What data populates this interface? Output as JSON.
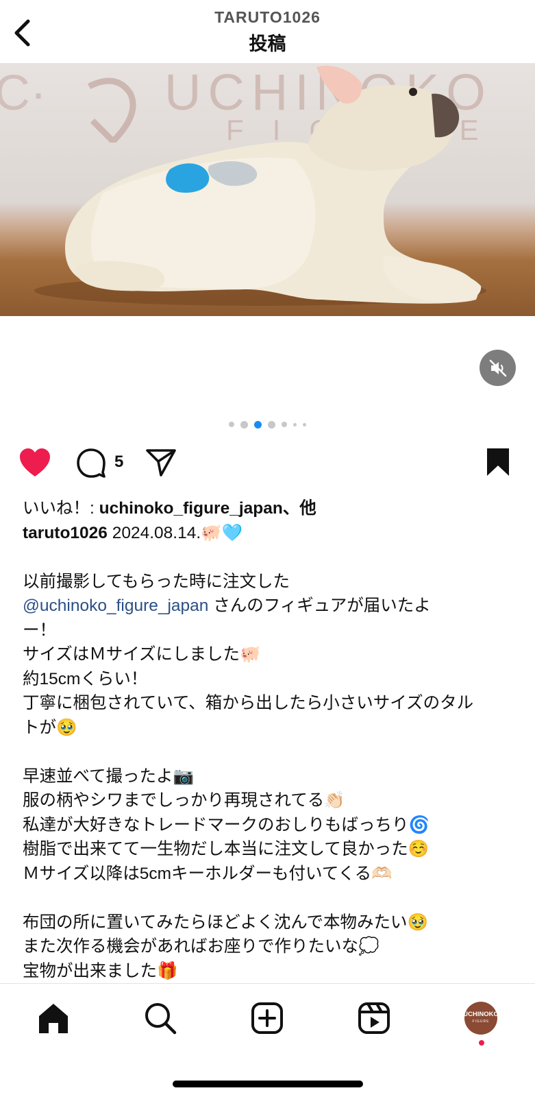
{
  "header": {
    "username": "TARUTO1026",
    "title": "投稿"
  },
  "media": {
    "watermark_text": "UCHINOKO",
    "watermark_sub": "FIGURE",
    "carousel_total": 7,
    "carousel_active_index": 2
  },
  "actions": {
    "comment_count": "5"
  },
  "caption": {
    "likes_text": "uchinoko_figure_japan、他",
    "likes_prefix": "いいね！: ",
    "author": "taruto1026",
    "date_line": " 2024.08.14.🐖🩵",
    "lines": [
      "以前撮影してもらった時に注文した",
      "さんのフィギュアが届いたよ",
      "ー！",
      "サイズはＭサイズにしました🐖",
      "約15cmくらい！",
      "丁寧に梱包されていて、箱から出したら小さいサイズのタル",
      "トが🥹",
      "早速並べて撮ったよ📷",
      "服の柄やシワまでしっかり再現されてる👏🏻",
      "私達が大好きなトレードマークのおしりもばっちり🌀",
      "樹脂で出来てて一生物だし本当に注文して良かった☺️",
      "Ｍサイズ以降は5cmキーホルダーも付いてくる🫶🏻",
      "布団の所に置いてみたらほどよく沈んで本物みたい🥹",
      "また次作る機会があればお座りで作りたいな💭",
      "宝物が出来ました🎁"
    ],
    "mention": "@uchinoko_figure_japan"
  },
  "bottom_nav": {
    "avatar_text": "UCHINOKO",
    "avatar_sub": "FIGURE"
  },
  "colors": {
    "heart": "#ee1d4f",
    "mention": "#2a4f85",
    "dot_active": "#1a8cf0",
    "dot_inactive": "#c8c8c8"
  }
}
